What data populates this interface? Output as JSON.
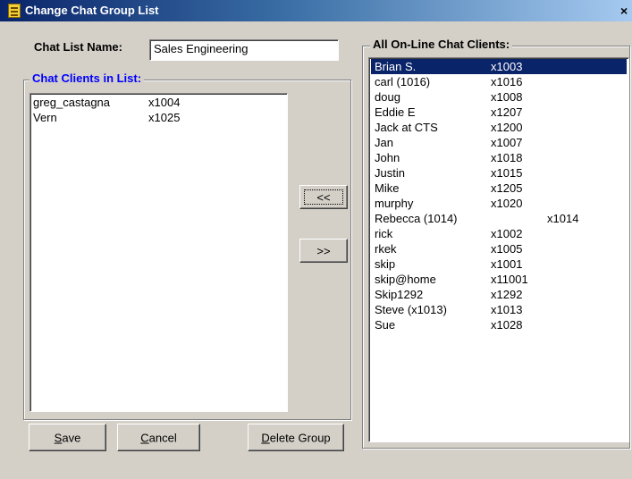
{
  "window": {
    "title": "Change Chat Group List",
    "icon": "notepad-list-icon",
    "close_glyph": "×"
  },
  "chat_list_name": {
    "label": "Chat List Name:",
    "value": "Sales Engineering"
  },
  "in_list": {
    "caption": "Chat Clients in List:",
    "caption_color": "#0000ff",
    "items": [
      {
        "name": "greg_castagna",
        "ext": "x1004"
      },
      {
        "name": "Vern",
        "ext": "x1025"
      }
    ]
  },
  "online": {
    "caption": "All On-Line Chat Clients:",
    "selected_index": 0,
    "items": [
      {
        "name": "Brian S.",
        "ext": "x1003"
      },
      {
        "name": "carl (1016)",
        "ext": "x1016"
      },
      {
        "name": "doug",
        "ext": "x1008"
      },
      {
        "name": "Eddie E",
        "ext": "x1207"
      },
      {
        "name": "Jack at CTS",
        "ext": "x1200"
      },
      {
        "name": "Jan",
        "ext": "x1007"
      },
      {
        "name": "John",
        "ext": "x1018"
      },
      {
        "name": "Justin",
        "ext": "x1015"
      },
      {
        "name": "Mike",
        "ext": "x1205"
      },
      {
        "name": "murphy",
        "ext": "x1020"
      },
      {
        "name": "Rebecca (1014)",
        "ext": "x1014"
      },
      {
        "name": "rick",
        "ext": "x1002"
      },
      {
        "name": "rkek",
        "ext": "x1005"
      },
      {
        "name": "skip",
        "ext": "x1001"
      },
      {
        "name": "skip@home",
        "ext": "x11001"
      },
      {
        "name": "Skip1292",
        "ext": "x1292"
      },
      {
        "name": "Steve (x1013)",
        "ext": "x1013"
      },
      {
        "name": "Sue",
        "ext": "x1028"
      }
    ]
  },
  "buttons": {
    "add": "<<",
    "remove": ">>",
    "save_prefix": "S",
    "save_rest": "ave",
    "cancel_prefix": "C",
    "cancel_rest": "ancel",
    "delete_prefix": "D",
    "delete_rest": "elete Group"
  }
}
